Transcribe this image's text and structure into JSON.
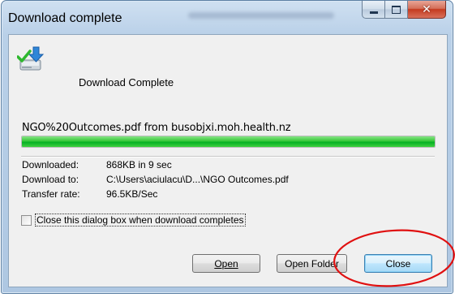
{
  "window": {
    "title": "Download complete",
    "controls": [
      "minimize-icon",
      "maximize-icon",
      "close-icon"
    ]
  },
  "header": {
    "icon": "download-complete-icon",
    "text": "Download Complete"
  },
  "download": {
    "file_line": "NGO%20Outcomes.pdf from busobjxi.moh.health.nz",
    "progress": 1.0,
    "rows": [
      {
        "label": "Downloaded:",
        "value": "868KB in 9 sec"
      },
      {
        "label": "Download to:",
        "value": "C:\\Users\\aciulacu\\D...\\NGO Outcomes.pdf"
      },
      {
        "label": "Transfer rate:",
        "value": "96.5KB/Sec"
      }
    ]
  },
  "checkbox": {
    "label": "Close this dialog box when download completes",
    "checked": false
  },
  "buttons": {
    "open": "Open",
    "open_folder": "Open Folder",
    "close": "Close"
  },
  "colors": {
    "progress": "#06b025",
    "annotation": "#e01010"
  }
}
